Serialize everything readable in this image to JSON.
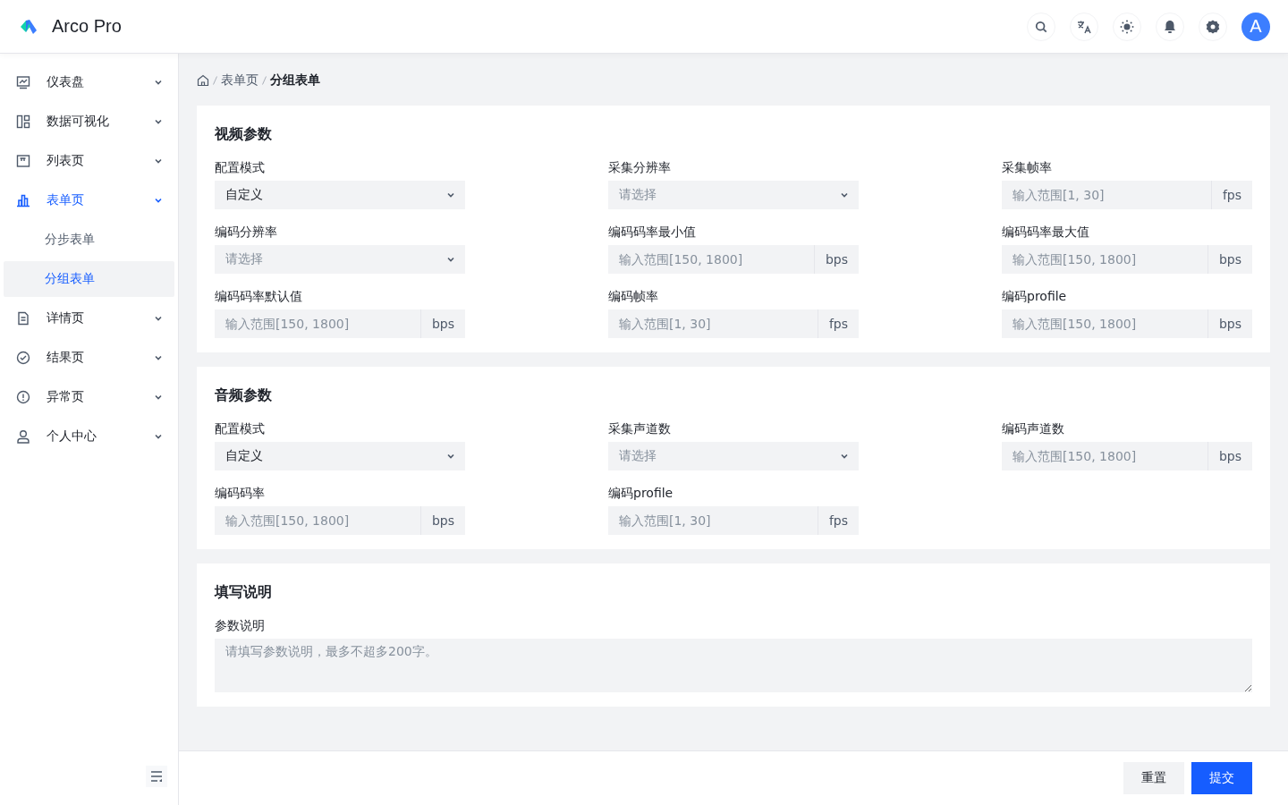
{
  "header": {
    "title": "Arco Pro",
    "tools": [
      {
        "kind": "search"
      },
      {
        "kind": "translate"
      },
      {
        "kind": "sun"
      },
      {
        "kind": "bell"
      },
      {
        "kind": "settings"
      }
    ],
    "avatar": "A"
  },
  "menu": [
    {
      "kind": "dashboard",
      "label": "仪表盘",
      "selected": false
    },
    {
      "kind": "chart",
      "label": "数据可视化",
      "selected": false
    },
    {
      "kind": "list",
      "label": "列表页",
      "selected": false
    },
    {
      "kind": "form",
      "label": "表单页",
      "selected": true,
      "children": [
        {
          "label": "分步表单",
          "selected": false
        },
        {
          "label": "分组表单",
          "selected": true
        }
      ]
    },
    {
      "kind": "detail",
      "label": "详情页",
      "selected": false
    },
    {
      "kind": "result",
      "label": "结果页",
      "selected": false
    },
    {
      "kind": "exception",
      "label": "异常页",
      "selected": false
    },
    {
      "kind": "user",
      "label": "个人中心",
      "selected": false
    }
  ],
  "breadcrumb": [
    "表单页",
    "分组表单"
  ],
  "sections": [
    {
      "title": "视频参数",
      "fields": [
        {
          "kind": "select",
          "label": "配置模式",
          "value": "自定义"
        },
        {
          "kind": "select",
          "label": "采集分辨率",
          "placeholder": "请选择"
        },
        {
          "kind": "input",
          "label": "采集帧率",
          "placeholder": "输入范围[1, 30]",
          "suffix": "fps"
        },
        {
          "kind": "select",
          "label": "编码分辨率",
          "placeholder": "请选择"
        },
        {
          "kind": "input",
          "label": "编码码率最小值",
          "placeholder": "输入范围[150, 1800]",
          "suffix": "bps"
        },
        {
          "kind": "input",
          "label": "编码码率最大值",
          "placeholder": "输入范围[150, 1800]",
          "suffix": "bps"
        },
        {
          "kind": "input",
          "label": "编码码率默认值",
          "placeholder": "输入范围[150, 1800]",
          "suffix": "bps"
        },
        {
          "kind": "input",
          "label": "编码帧率",
          "placeholder": "输入范围[1, 30]",
          "suffix": "fps"
        },
        {
          "kind": "input",
          "label": "编码profile",
          "placeholder": "输入范围[150, 1800]",
          "suffix": "bps"
        }
      ]
    },
    {
      "title": "音频参数",
      "fields": [
        {
          "kind": "select",
          "label": "配置模式",
          "value": "自定义"
        },
        {
          "kind": "select",
          "label": "采集声道数",
          "placeholder": "请选择"
        },
        {
          "kind": "input",
          "label": "编码声道数",
          "placeholder": "输入范围[150, 1800]",
          "suffix": "bps"
        },
        {
          "kind": "input",
          "label": "编码码率",
          "placeholder": "输入范围[150, 1800]",
          "suffix": "bps"
        },
        {
          "kind": "input",
          "label": "编码profile",
          "placeholder": "输入范围[1, 30]",
          "suffix": "fps"
        }
      ]
    },
    {
      "title": "填写说明",
      "fields": [
        {
          "kind": "textarea",
          "label": "参数说明",
          "placeholder": "请填写参数说明，最多不超多200字。"
        }
      ]
    }
  ],
  "actions": [
    {
      "label": "重置",
      "kind": "secondary"
    },
    {
      "label": "提交",
      "kind": "primary"
    }
  ]
}
